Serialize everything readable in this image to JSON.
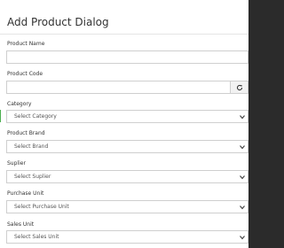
{
  "dialog": {
    "title": "Add Product Dialog"
  },
  "fields": {
    "product_name": {
      "label": "Product Name",
      "value": ""
    },
    "product_code": {
      "label": "Product Code",
      "value": ""
    },
    "category": {
      "label": "Category",
      "selected": "Select Category"
    },
    "product_brand": {
      "label": "Product Brand",
      "selected": "Select Brand"
    },
    "supplier": {
      "label": "Suplier",
      "selected": "Select Suplier"
    },
    "purchase_unit": {
      "label": "Purchase Unit",
      "selected": "Select Purchase Unit"
    },
    "sales_unit": {
      "label": "Sales Unit",
      "selected": "Select Sales Unit"
    }
  },
  "icons": {
    "refresh": "refresh-icon",
    "dropdown": "chevron-down-icon"
  }
}
